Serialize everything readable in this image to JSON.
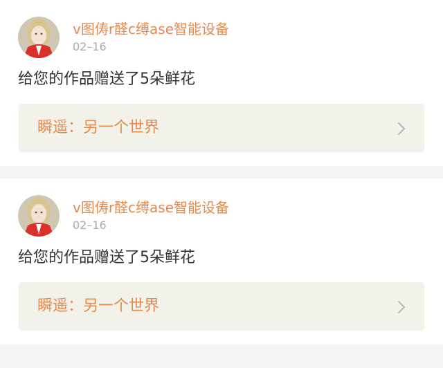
{
  "notifications": [
    {
      "username": "v图俦r醛c缚ase智能设备",
      "time": "02–16",
      "message": "给您的作品赠送了5朵鲜花",
      "work_title": "瞬遥：另一个世界",
      "icons": {
        "avatar": "user-avatar",
        "arrow": "chevron-right-icon"
      }
    },
    {
      "username": "v图俦r醛c缚ase智能设备",
      "time": "02–16",
      "message": "给您的作品赠送了5朵鲜花",
      "work_title": "瞬遥：另一个世界",
      "icons": {
        "avatar": "user-avatar",
        "arrow": "chevron-right-icon"
      }
    }
  ],
  "colors": {
    "accent": "#e58a4e",
    "timestamp": "#a9a9a9",
    "text": "#333333",
    "link_background": "#f2f2ea",
    "page_background": "#f4f4f4"
  }
}
